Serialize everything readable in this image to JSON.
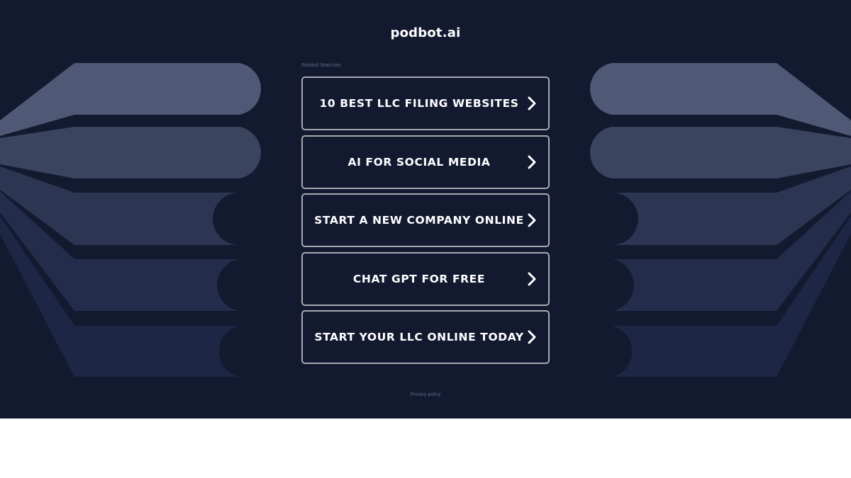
{
  "site": {
    "title": "podbot.ai"
  },
  "related": {
    "label": "Related Searches",
    "items": [
      {
        "label": "10 BEST LLC FILING WEBSITES",
        "icon": "chevron-right-icon"
      },
      {
        "label": "AI FOR SOCIAL MEDIA",
        "icon": "chevron-right-icon"
      },
      {
        "label": "START A NEW COMPANY ONLINE",
        "icon": "chevron-right-icon"
      },
      {
        "label": "CHAT GPT FOR FREE",
        "icon": "chevron-right-icon"
      },
      {
        "label": "START YOUR LLC ONLINE TODAY",
        "icon": "chevron-right-icon"
      }
    ]
  },
  "footer": {
    "privacy_label": "Privacy policy"
  },
  "colors": {
    "background": "#131a30",
    "button_border": "#a7a9af",
    "text": "#ffffff",
    "muted_text": "#5e6580",
    "band_1": "#4f5975",
    "band_2": "#3a445f",
    "band_3": "#2c3552",
    "band_4": "#232c4a",
    "band_5": "#1d2644"
  }
}
